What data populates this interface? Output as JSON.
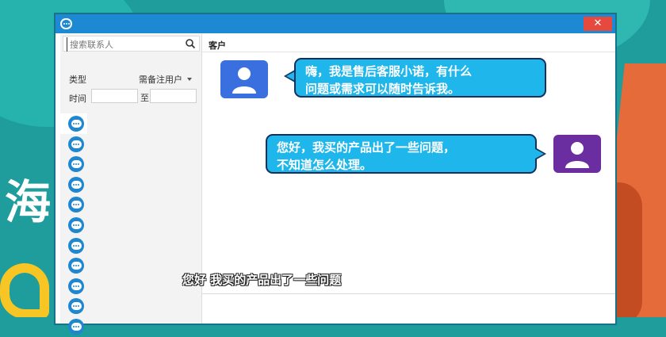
{
  "window": {
    "close_label": "✕",
    "accent_color": "#1d89d2"
  },
  "sidebar": {
    "search_placeholder": "搜索联系人",
    "filter": {
      "type_label": "类型",
      "type_value": "需备注用户",
      "time_label": "时间",
      "time_to": "至"
    },
    "contact_count": 11
  },
  "chat": {
    "header": "客户",
    "messages": [
      {
        "from": "agent",
        "line1": "嗨，我是售后客服小诺，有什么",
        "line2": "问题或需求可以随时告诉我。"
      },
      {
        "from": "user",
        "line1": "您好，我买的产品出了一些问题，",
        "line2": "不知道怎么处理。"
      }
    ]
  },
  "subtitle": "您好 我买的产品出了一些问题",
  "background": {
    "big_text": "海"
  }
}
